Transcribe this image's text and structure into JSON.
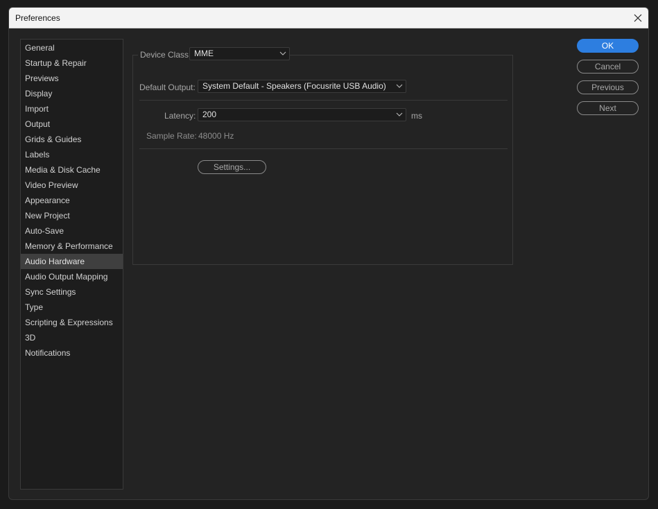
{
  "window": {
    "title": "Preferences"
  },
  "sidebar": {
    "items": [
      {
        "label": "General"
      },
      {
        "label": "Startup & Repair"
      },
      {
        "label": "Previews"
      },
      {
        "label": "Display"
      },
      {
        "label": "Import"
      },
      {
        "label": "Output"
      },
      {
        "label": "Grids & Guides"
      },
      {
        "label": "Labels"
      },
      {
        "label": "Media & Disk Cache"
      },
      {
        "label": "Video Preview"
      },
      {
        "label": "Appearance"
      },
      {
        "label": "New Project"
      },
      {
        "label": "Auto-Save"
      },
      {
        "label": "Memory & Performance"
      },
      {
        "label": "Audio Hardware"
      },
      {
        "label": "Audio Output Mapping"
      },
      {
        "label": "Sync Settings"
      },
      {
        "label": "Type"
      },
      {
        "label": "Scripting & Expressions"
      },
      {
        "label": "3D"
      },
      {
        "label": "Notifications"
      }
    ],
    "selected": "Audio Hardware"
  },
  "panel": {
    "device_class_label": "Device Class:",
    "device_class_value": "MME",
    "default_output_label": "Default Output:",
    "default_output_value": "System Default - Speakers (Focusrite USB Audio)",
    "latency_label": "Latency:",
    "latency_value": "200",
    "latency_unit": "ms",
    "sample_rate_label": "Sample Rate:",
    "sample_rate_value": "48000 Hz",
    "settings_button": "Settings..."
  },
  "buttons": {
    "ok": "OK",
    "cancel": "Cancel",
    "previous": "Previous",
    "next": "Next"
  },
  "colors": {
    "accent": "#2d7ee0",
    "background": "#232323",
    "selected_item": "#3f3f3f"
  },
  "icons": [
    "close-icon",
    "chevron-down-icon"
  ]
}
